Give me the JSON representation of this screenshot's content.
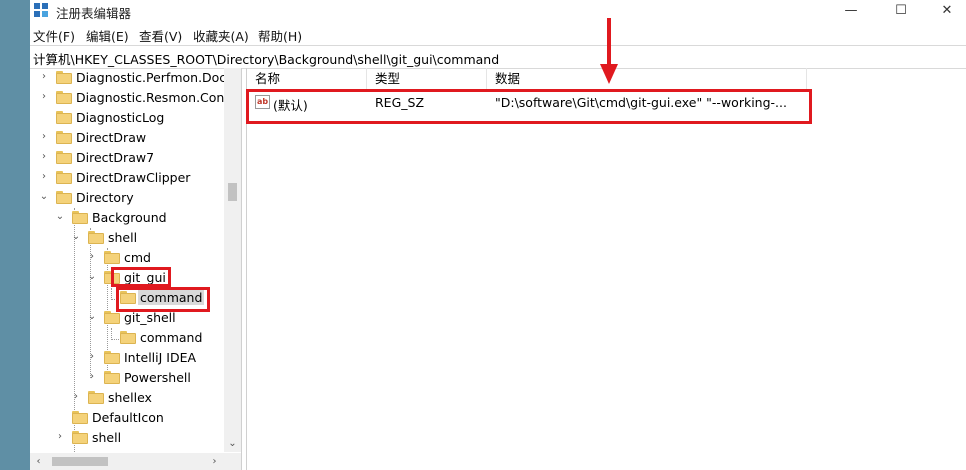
{
  "window": {
    "title": "注册表编辑器",
    "controls": {
      "minimize": "—",
      "maximize": "☐",
      "close": "✕"
    }
  },
  "menu": [
    "文件(F)",
    "编辑(E)",
    "查看(V)",
    "收藏夹(A)",
    "帮助(H)"
  ],
  "address": "计算机\\HKEY_CLASSES_ROOT\\Directory\\Background\\shell\\git_gui\\command",
  "tree": [
    {
      "label": "Diagnostic.Perfmon.Docu",
      "expander": "›"
    },
    {
      "label": "Diagnostic.Resmon.Config",
      "expander": "›"
    },
    {
      "label": "DiagnosticLog",
      "expander": ""
    },
    {
      "label": "DirectDraw",
      "expander": "›"
    },
    {
      "label": "DirectDraw7",
      "expander": "›"
    },
    {
      "label": "DirectDrawClipper",
      "expander": "›"
    },
    {
      "label": "Directory",
      "expander": "⌄"
    },
    {
      "label": "Background",
      "expander": "⌄"
    },
    {
      "label": "shell",
      "expander": "⌄"
    },
    {
      "label": "cmd",
      "expander": "›"
    },
    {
      "label": "git_gui",
      "expander": "⌄"
    },
    {
      "label": "command",
      "expander": ""
    },
    {
      "label": "git_shell",
      "expander": "⌄"
    },
    {
      "label": "command",
      "expander": ""
    },
    {
      "label": "IntelliJ IDEA",
      "expander": "›"
    },
    {
      "label": "Powershell",
      "expander": "›"
    },
    {
      "label": "shellex",
      "expander": "›"
    },
    {
      "label": "DefaultIcon",
      "expander": ""
    },
    {
      "label": "shell",
      "expander": "›"
    }
  ],
  "list": {
    "columns": [
      "名称",
      "类型",
      "数据"
    ],
    "rows": [
      {
        "icon": "ab",
        "name": "(默认)",
        "type": "REG_SZ",
        "data": "\"D:\\software\\Git\\cmd\\git-gui.exe\" \"--working-..."
      }
    ]
  },
  "colors": {
    "highlight": "#e0191f",
    "selected": "#d9d9d9",
    "folder": "#f4d27a"
  }
}
